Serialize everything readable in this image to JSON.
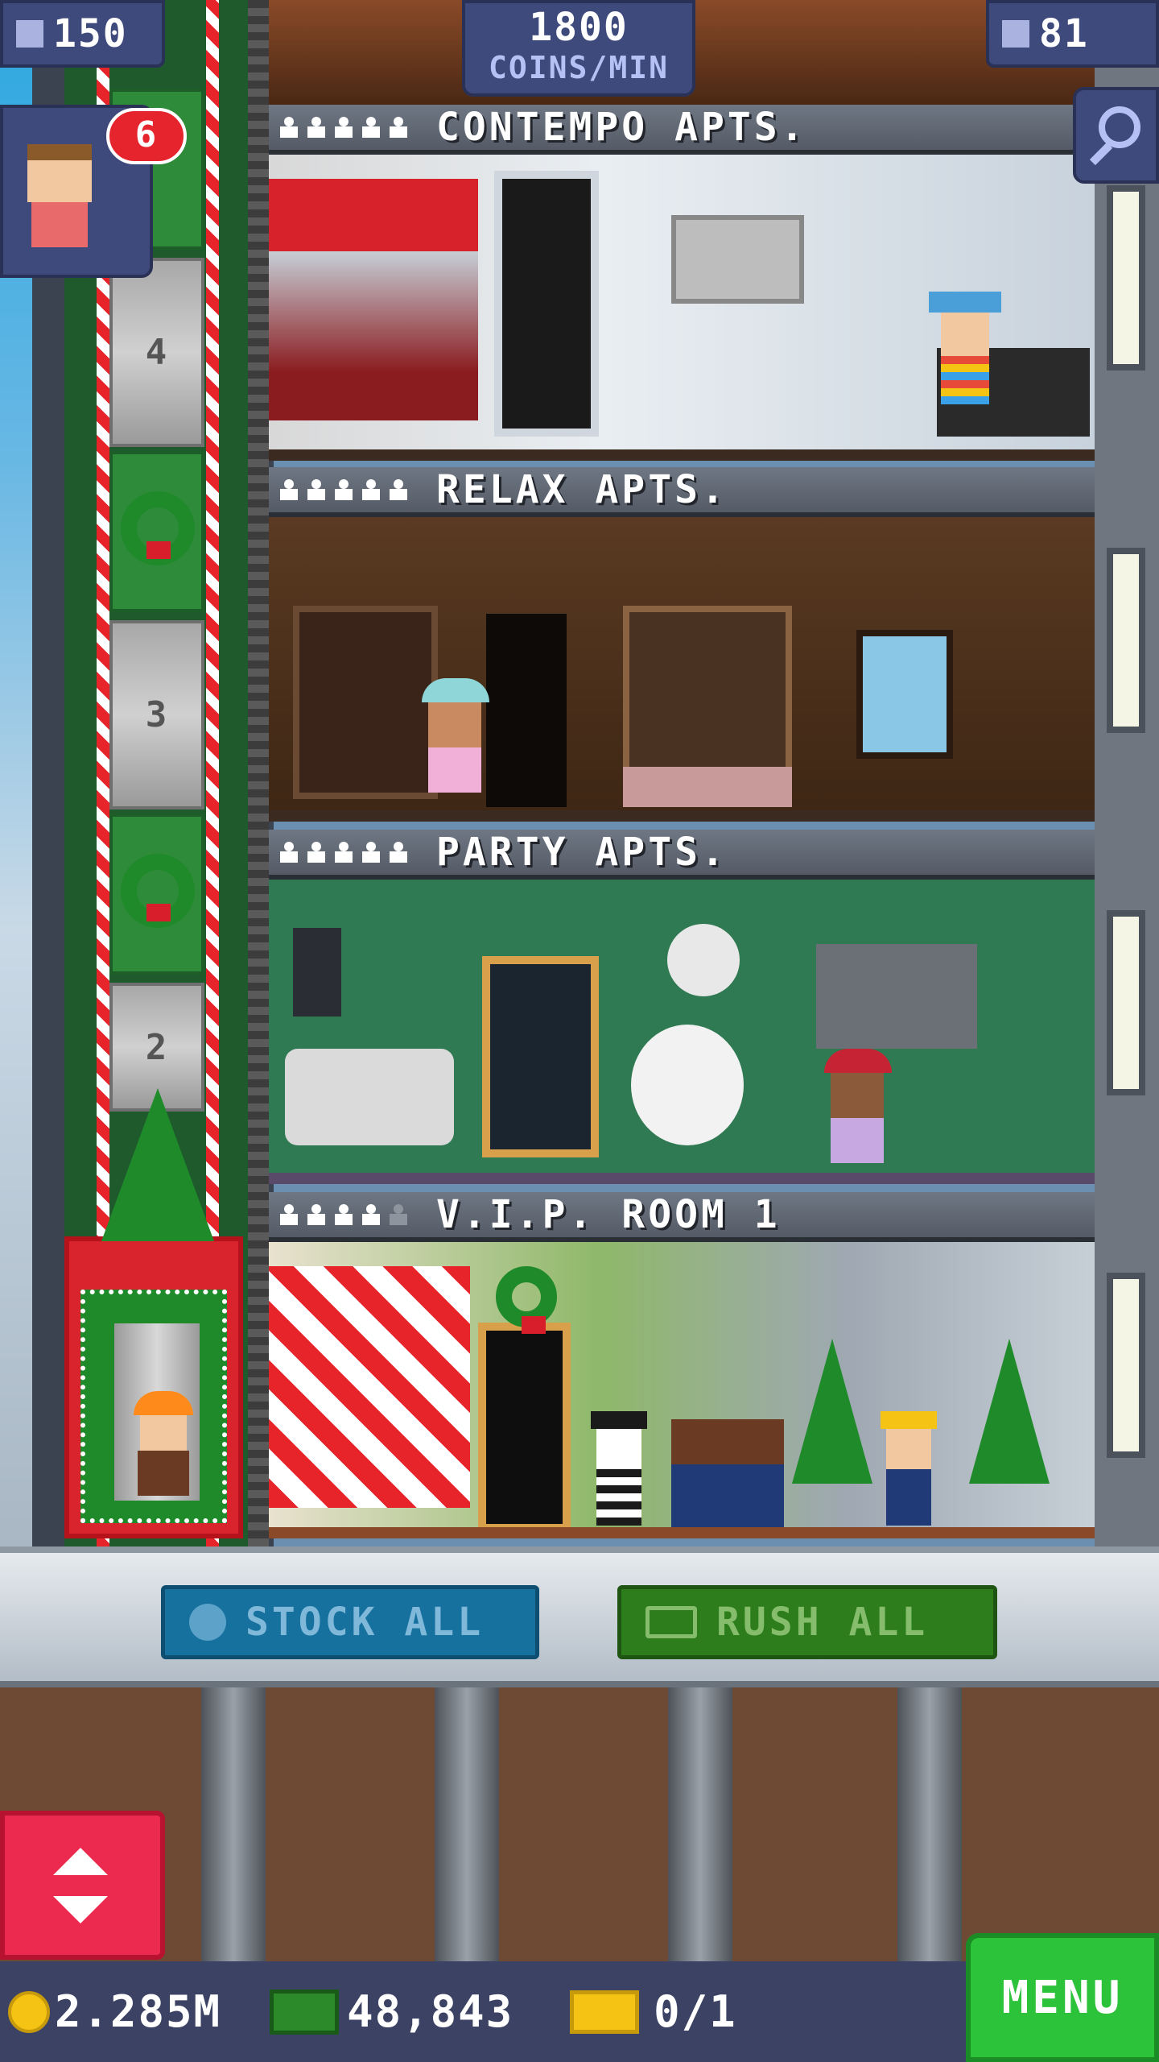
{
  "hud": {
    "population": "150",
    "coins_per_min": "1800",
    "coins_per_min_unit": "COINS/MIN",
    "floor_count": "81"
  },
  "visitor": {
    "badge_count": "6"
  },
  "shaft_floor_numbers": [
    "4",
    "3",
    "2"
  ],
  "floors": [
    {
      "name": "CONTEMPO APTS.",
      "stars_filled": 5,
      "stars_total": 5
    },
    {
      "name": "RELAX APTS.",
      "stars_filled": 5,
      "stars_total": 5
    },
    {
      "name": "PARTY APTS.",
      "stars_filled": 5,
      "stars_total": 5
    },
    {
      "name": "V.I.P. ROOM 1",
      "stars_filled": 4,
      "stars_total": 5
    }
  ],
  "lobby": {
    "stock_all_label": "STOCK ALL",
    "rush_all_label": "RUSH ALL"
  },
  "bottom": {
    "coins": "2.285M",
    "tower_bux": "48,843",
    "tickets": "0/1",
    "menu_label": "MENU"
  },
  "colors": {
    "hud_panel": "#3f4a7c",
    "stock_button": "#16719e",
    "rush_button": "#2d7d1c",
    "menu_button": "#2cc23a",
    "elevator_red": "#d9232d",
    "badge_red": "#e5242e"
  }
}
